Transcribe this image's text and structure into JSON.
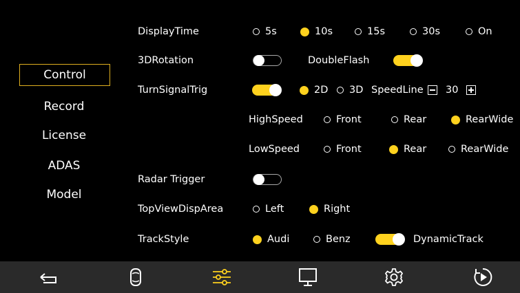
{
  "sidebar": {
    "items": [
      {
        "label": "Control",
        "active": true
      },
      {
        "label": "Record",
        "active": false
      },
      {
        "label": "License",
        "active": false
      },
      {
        "label": "ADAS",
        "active": false
      },
      {
        "label": "Model",
        "active": false
      }
    ]
  },
  "settings": {
    "display_time": {
      "label": "DisplayTime",
      "options": [
        "5s",
        "10s",
        "15s",
        "30s",
        "On"
      ],
      "selected": "10s"
    },
    "rotation_3d": {
      "label": "3DRotation",
      "on": false
    },
    "double_flash": {
      "label": "DoubleFlash",
      "on": true
    },
    "turn_signal": {
      "label": "TurnSignalTrig",
      "on": true,
      "options": [
        "2D",
        "3D"
      ],
      "selected": "2D",
      "speedline_label": "SpeedLine",
      "speedline_value": "30"
    },
    "high_speed": {
      "label": "HighSpeed",
      "options": [
        "Front",
        "Rear",
        "RearWide"
      ],
      "selected": "RearWide"
    },
    "low_speed": {
      "label": "LowSpeed",
      "options": [
        "Front",
        "Rear",
        "RearWide"
      ],
      "selected": "Rear"
    },
    "radar_trigger": {
      "label": "Radar Trigger",
      "on": false
    },
    "top_view": {
      "label": "TopViewDispArea",
      "options": [
        "Left",
        "Right"
      ],
      "selected": "Right"
    },
    "track_style": {
      "label": "TrackStyle",
      "options": [
        "Audi",
        "Benz"
      ],
      "selected": "Audi",
      "dynamic_label": "DynamicTrack",
      "dynamic_on": true
    }
  },
  "bottom_nav": {
    "items": [
      "back-icon",
      "car-icon",
      "sliders-icon",
      "monitor-icon",
      "gear-icon",
      "play-icon"
    ],
    "active": "sliders-icon"
  },
  "colors": {
    "accent": "#ffd21e",
    "background": "#000000",
    "bar": "#2a2a2a"
  }
}
